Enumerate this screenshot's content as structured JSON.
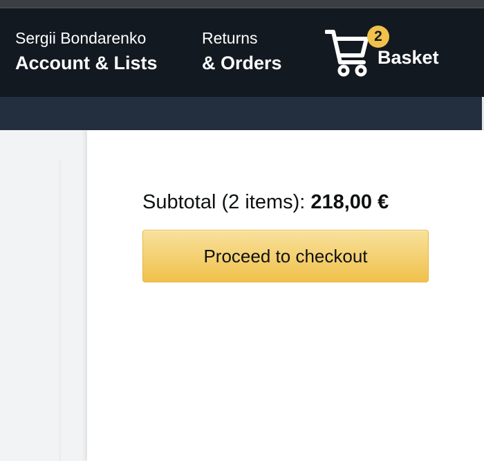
{
  "header": {
    "account": {
      "greeting": "Sergii Bondarenko",
      "label": "Account & Lists"
    },
    "returns": {
      "line1": "Returns",
      "line2": "& Orders"
    },
    "basket": {
      "count": "2",
      "label": "Basket",
      "icon": "cart-icon"
    }
  },
  "cart_summary": {
    "subtotal_label": "Subtotal (2 items):",
    "subtotal_amount": "218,00 €",
    "checkout_label": "Proceed to checkout"
  },
  "colors": {
    "nav_bg": "#131921",
    "subnav_bg": "#232f3e",
    "badge": "#f0c14b",
    "button_top": "#f8e19c",
    "button_bottom": "#f0c14b"
  }
}
